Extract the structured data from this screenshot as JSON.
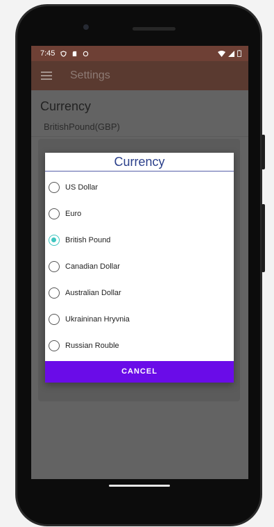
{
  "status_bar": {
    "time": "7:45",
    "icons": [
      "shield-icon",
      "sd-card-icon",
      "sync-icon"
    ],
    "right_icons": [
      "wifi-icon",
      "signal-icon",
      "battery-icon"
    ]
  },
  "app_bar": {
    "menu_icon": "menu-icon",
    "title": "Settings"
  },
  "preference": {
    "title": "Currency",
    "summary": "BritishPound(GBP)"
  },
  "dialog": {
    "title": "Currency",
    "options": [
      {
        "label": "US Dollar",
        "selected": false
      },
      {
        "label": "Euro",
        "selected": false
      },
      {
        "label": "British Pound",
        "selected": true
      },
      {
        "label": "Canadian Dollar",
        "selected": false
      },
      {
        "label": "Australian Dollar",
        "selected": false
      },
      {
        "label": "Ukraininan Hryvnia",
        "selected": false
      },
      {
        "label": "Russian Rouble",
        "selected": false
      }
    ],
    "cancel_label": "CANCEL"
  },
  "colors": {
    "status_bar": "#6e4035",
    "app_bar": "#5a3a30",
    "accent_radio": "#3fc6c0",
    "cancel_button": "#6a0ce8",
    "dialog_title": "#2a3f8a"
  }
}
